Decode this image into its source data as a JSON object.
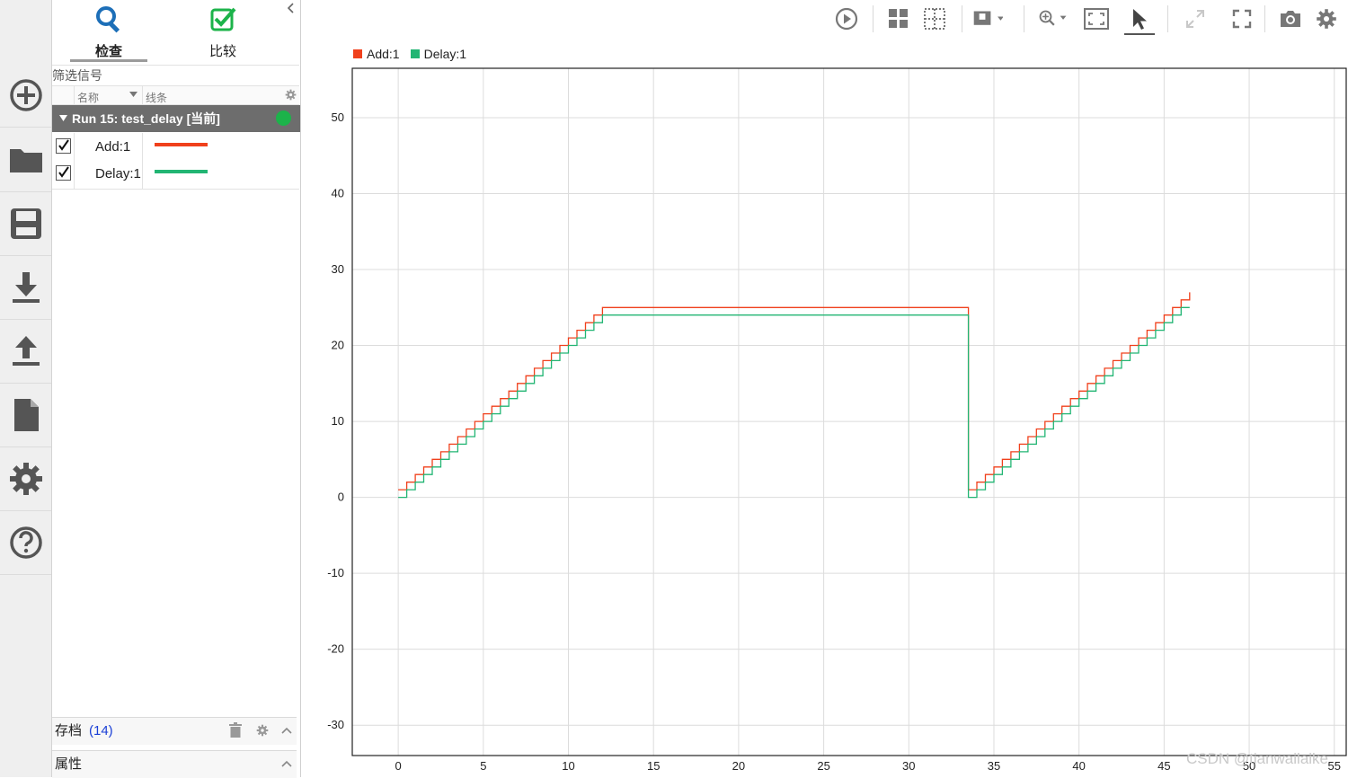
{
  "rail": {
    "items": [
      "add-icon",
      "folder-icon",
      "save-icon",
      "download-icon",
      "upload-icon",
      "document-icon",
      "gear-icon",
      "help-icon"
    ]
  },
  "tabs": [
    {
      "label": "检查",
      "icon": "search-icon"
    },
    {
      "label": "比较",
      "icon": "compare-check-icon"
    }
  ],
  "filter": {
    "placeholder": "筛选信号"
  },
  "columns": {
    "name": "名称",
    "line": "线条"
  },
  "run": {
    "label": "Run 15: test_delay [当前]",
    "status_color": "#1cb34a"
  },
  "signals": [
    {
      "name": "Add:1",
      "color": "#f0401c",
      "checked": true
    },
    {
      "name": "Delay:1",
      "color": "#22b573",
      "checked": true
    }
  ],
  "archive": {
    "label": "存档",
    "count": "(14)"
  },
  "properties": {
    "label": "属性"
  },
  "legend": [
    {
      "label": "Add:1",
      "color": "#f0401c"
    },
    {
      "label": "Delay:1",
      "color": "#22b573"
    }
  ],
  "chart_data": {
    "type": "line",
    "title": "",
    "xlabel": "",
    "ylabel": "",
    "xlim": [
      -2.7,
      55.7
    ],
    "ylim": [
      -34,
      56.5
    ],
    "xticks": [
      0,
      5,
      10,
      15,
      20,
      25,
      30,
      35,
      40,
      45,
      50,
      55
    ],
    "yticks": [
      -30,
      -20,
      -10,
      0,
      10,
      20,
      30,
      40,
      50
    ],
    "grid": true,
    "series": [
      {
        "name": "Add:1",
        "color": "#f0401c",
        "description": "staircase: value = step count + 1, steps of 0.5 time units from t=0 up to 25 at t=12, hold at 25 until t=33.5, reset to 1 and climb again to 27 at t=46.5",
        "segments": [
          {
            "t_start": 0,
            "t_end": 12,
            "v_start": 1,
            "step": 0.5,
            "v_end": 25
          },
          {
            "t_start": 12,
            "t_end": 33.5,
            "v_start": 25,
            "step": 0,
            "v_end": 25
          },
          {
            "t_start": 33.5,
            "t_end": 46.5,
            "v_start": 1,
            "step": 0.5,
            "v_end": 27
          }
        ]
      },
      {
        "name": "Delay:1",
        "color": "#22b573",
        "description": "Add:1 delayed by one sample",
        "segments": [
          {
            "t_start": 0,
            "t_end": 12,
            "v_start": 0,
            "step": 0.5,
            "v_end": 24
          },
          {
            "t_start": 12,
            "t_end": 33.5,
            "v_start": 24,
            "step": 0,
            "v_end": 24
          },
          {
            "t_start": 33.5,
            "t_end": 46.5,
            "v_start": 0,
            "step": 0.5,
            "v_end": 25
          }
        ]
      }
    ]
  },
  "watermark": "CSDN @tianwailaike"
}
